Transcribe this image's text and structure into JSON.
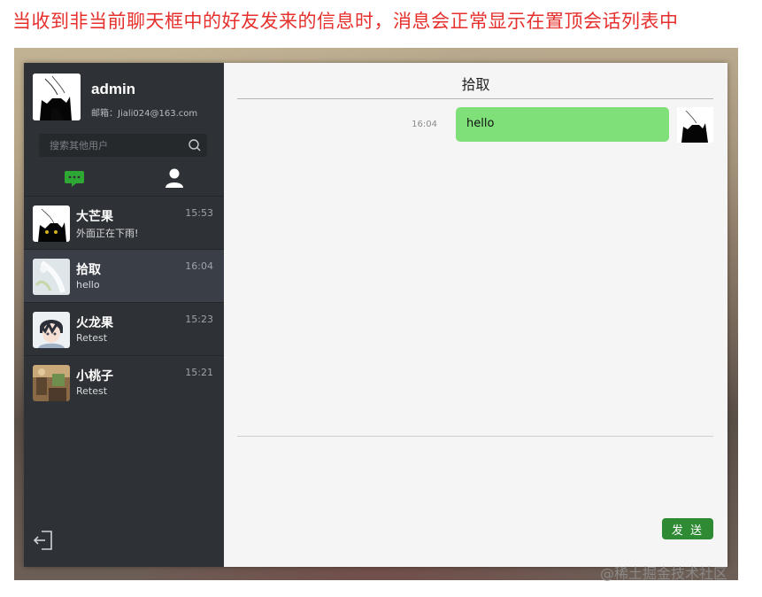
{
  "caption": "当收到非当前聊天框中的好友发来的信息时，消息会正常显示在置顶会话列表中",
  "sidebar": {
    "user": {
      "name": "admin",
      "email": "邮箱：Jiali024@163.com"
    },
    "search": {
      "placeholder": "搜索其他用户",
      "icon": "search-icon"
    },
    "tabs": [
      {
        "icon": "chat-bubble-icon",
        "color": "#2ea834"
      },
      {
        "icon": "person-icon",
        "color": "#ffffff"
      }
    ],
    "contacts": [
      {
        "name": "大芒果",
        "last_message": "外面正在下雨!",
        "time": "15:53"
      },
      {
        "name": "拾取",
        "last_message": "hello",
        "time": "16:04"
      },
      {
        "name": "火龙果",
        "last_message": "Retest",
        "time": "15:23"
      },
      {
        "name": "小桃子",
        "last_message": "Retest",
        "time": "15:21"
      }
    ],
    "active_contact": "拾取"
  },
  "chat": {
    "title": "拾取",
    "messages": [
      {
        "time": "16:04",
        "text": "hello",
        "direction": "outgoing",
        "bubble_color": "#7fe07a"
      }
    ],
    "send_label": "发 送",
    "send_color": "#2f8a34"
  },
  "watermark": "@稀土掘金技术社区"
}
